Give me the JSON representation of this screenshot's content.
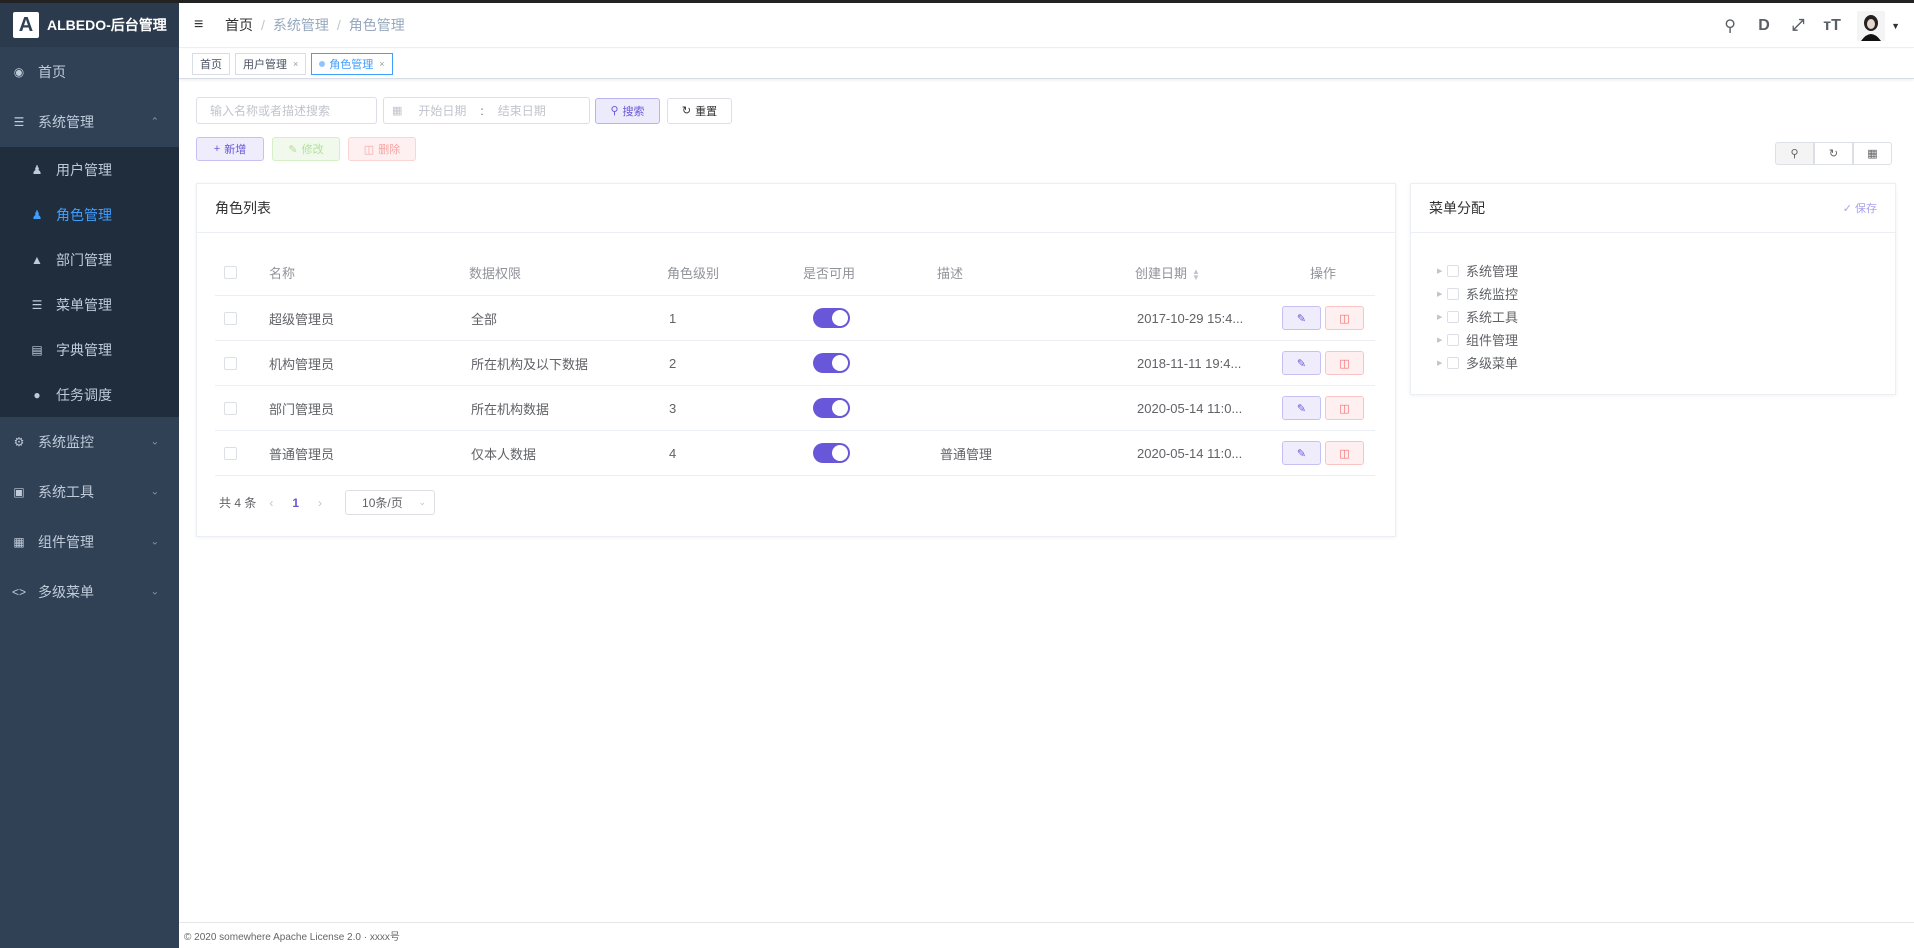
{
  "app": {
    "logo_letter": "A",
    "title": "ALBEDO-后台管理"
  },
  "sidebar": {
    "items": [
      {
        "label": "首页",
        "icon": "dashboard-icon"
      },
      {
        "label": "系统管理",
        "icon": "menu-list-icon",
        "expanded": true
      },
      {
        "label": "系统监控",
        "icon": "gear-icon"
      },
      {
        "label": "系统工具",
        "icon": "toolbox-icon"
      },
      {
        "label": "组件管理",
        "icon": "grid-icon"
      },
      {
        "label": "多级菜单",
        "icon": "code-icon"
      }
    ],
    "sub_items": [
      {
        "label": "用户管理",
        "icon": "users-icon"
      },
      {
        "label": "角色管理",
        "icon": "role-icon",
        "active": true
      },
      {
        "label": "部门管理",
        "icon": "org-icon"
      },
      {
        "label": "菜单管理",
        "icon": "menu-icon"
      },
      {
        "label": "字典管理",
        "icon": "book-icon"
      },
      {
        "label": "任务调度",
        "icon": "clock-icon"
      }
    ]
  },
  "breadcrumb": {
    "items": [
      "首页",
      "系统管理",
      "角色管理"
    ],
    "separator": "/"
  },
  "tags": [
    {
      "label": "首页"
    },
    {
      "label": "用户管理",
      "close": "×"
    },
    {
      "label": "角色管理",
      "close": "×",
      "active": true
    }
  ],
  "filter": {
    "search_placeholder": "输入名称或者描述搜索",
    "start_date_placeholder": "开始日期",
    "range_separator": ":",
    "end_date_placeholder": "结束日期",
    "search_label": "搜索",
    "reset_label": "重置"
  },
  "actions": {
    "add_label": "新增",
    "edit_label": "修改",
    "delete_label": "删除"
  },
  "role_card": {
    "title": "角色列表",
    "columns": [
      "名称",
      "数据权限",
      "角色级别",
      "是否可用",
      "描述",
      "创建日期",
      "操作"
    ],
    "rows": [
      {
        "name": "超级管理员",
        "scope": "全部",
        "level": "1",
        "enabled": true,
        "desc": "",
        "date": "2017-10-29 15:4..."
      },
      {
        "name": "机构管理员",
        "scope": "所在机构及以下数据",
        "level": "2",
        "enabled": true,
        "desc": "",
        "date": "2018-11-11 19:4..."
      },
      {
        "name": "部门管理员",
        "scope": "所在机构数据",
        "level": "3",
        "enabled": true,
        "desc": "",
        "date": "2020-05-14 11:0..."
      },
      {
        "name": "普通管理员",
        "scope": "仅本人数据",
        "level": "4",
        "enabled": true,
        "desc": "普通管理",
        "date": "2020-05-14 11:0..."
      }
    ],
    "pagination": {
      "total": "共 4 条",
      "current_page": "1",
      "page_size": "10条/页"
    }
  },
  "menu_card": {
    "title": "菜单分配",
    "save_label": "保存",
    "tree": [
      "系统管理",
      "系统监控",
      "系统工具",
      "组件管理",
      "多级菜单"
    ]
  },
  "footer": {
    "text": "© 2020 somewhere Apache License 2.0 · xxxx号"
  },
  "colors": {
    "primary": "#6857d8",
    "sidebar_bg": "#304156",
    "active_link": "#409eff",
    "danger": "#f56c6c"
  }
}
